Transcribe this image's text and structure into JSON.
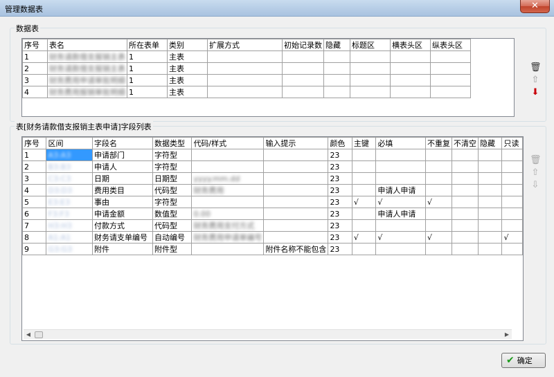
{
  "window": {
    "title": "管理数据表",
    "close_glyph": "✕"
  },
  "table_group": {
    "label": "数据表",
    "columns": [
      "序号",
      "表名",
      "所在表单",
      "类别",
      "扩展方式",
      "初始记录数",
      "隐藏",
      "标题区",
      "横表头区",
      "纵表头区"
    ],
    "rows": [
      [
        "1",
        "财务请款借支报销主表",
        "1",
        "主表",
        "",
        "",
        "",
        "",
        "",
        ""
      ],
      [
        "2",
        "财务请款借支报销主表",
        "1",
        "主表",
        "",
        "",
        "",
        "",
        "",
        ""
      ],
      [
        "3",
        "财务费用申请审批明细",
        "1",
        "主表",
        "",
        "",
        "",
        "",
        "",
        ""
      ],
      [
        "4",
        "财务费用报销审批明细",
        "1",
        "主表",
        "",
        "",
        "",
        "",
        "",
        ""
      ]
    ]
  },
  "field_group": {
    "label": "表[财务请款借支报销主表申请]字段列表",
    "columns": [
      "序号",
      "区间",
      "字段名",
      "数据类型",
      "代码/样式",
      "输入提示",
      "颜色",
      "主键",
      "必填",
      "不重复",
      "不清空",
      "隐藏",
      "只读"
    ],
    "rows": [
      [
        "1",
        "A3:A3",
        "申请部门",
        "字符型",
        "",
        "",
        "23",
        "",
        "",
        "",
        "",
        "",
        ""
      ],
      [
        "2",
        "B3:B3",
        "申请人",
        "字符型",
        "",
        "",
        "23",
        "",
        "",
        "",
        "",
        "",
        ""
      ],
      [
        "3",
        "C3:C3",
        "日期",
        "日期型",
        "yyyy.mm.dd",
        "",
        "23",
        "",
        "",
        "",
        "",
        "",
        ""
      ],
      [
        "4",
        "D3:D3",
        "费用类目",
        "代码型",
        "财务费用",
        "",
        "23",
        "",
        "申请人申请",
        "",
        "",
        "",
        ""
      ],
      [
        "5",
        "E3:E3",
        "事由",
        "字符型",
        "",
        "",
        "23",
        "√",
        "√",
        "√",
        "",
        "",
        ""
      ],
      [
        "6",
        "F3:F3",
        "申请金额",
        "数值型",
        "0.00",
        "",
        "23",
        "",
        "申请人申请",
        "",
        "",
        "",
        ""
      ],
      [
        "7",
        "H3:H3",
        "付款方式",
        "代码型",
        "财务费用支付方式",
        "",
        "23",
        "",
        "",
        "",
        "",
        "",
        ""
      ],
      [
        "8",
        "A1:A1",
        "财务请支单编号",
        "自动编号",
        "财务费用申请单编号",
        "",
        "23",
        "√",
        "√",
        "√",
        "",
        "",
        "√"
      ],
      [
        "9",
        "G3:G3",
        "附件",
        "附件型",
        "",
        "附件名称不能包含",
        "23",
        "",
        "",
        "",
        "",
        "",
        ""
      ]
    ]
  },
  "side_icons_top": [
    "trash-icon",
    "arrow-up-icon",
    "arrow-down-icon"
  ],
  "side_icons_bottom": [
    "trash-icon",
    "arrow-up-icon",
    "arrow-down-icon"
  ],
  "ok_button": {
    "label": "确定"
  }
}
